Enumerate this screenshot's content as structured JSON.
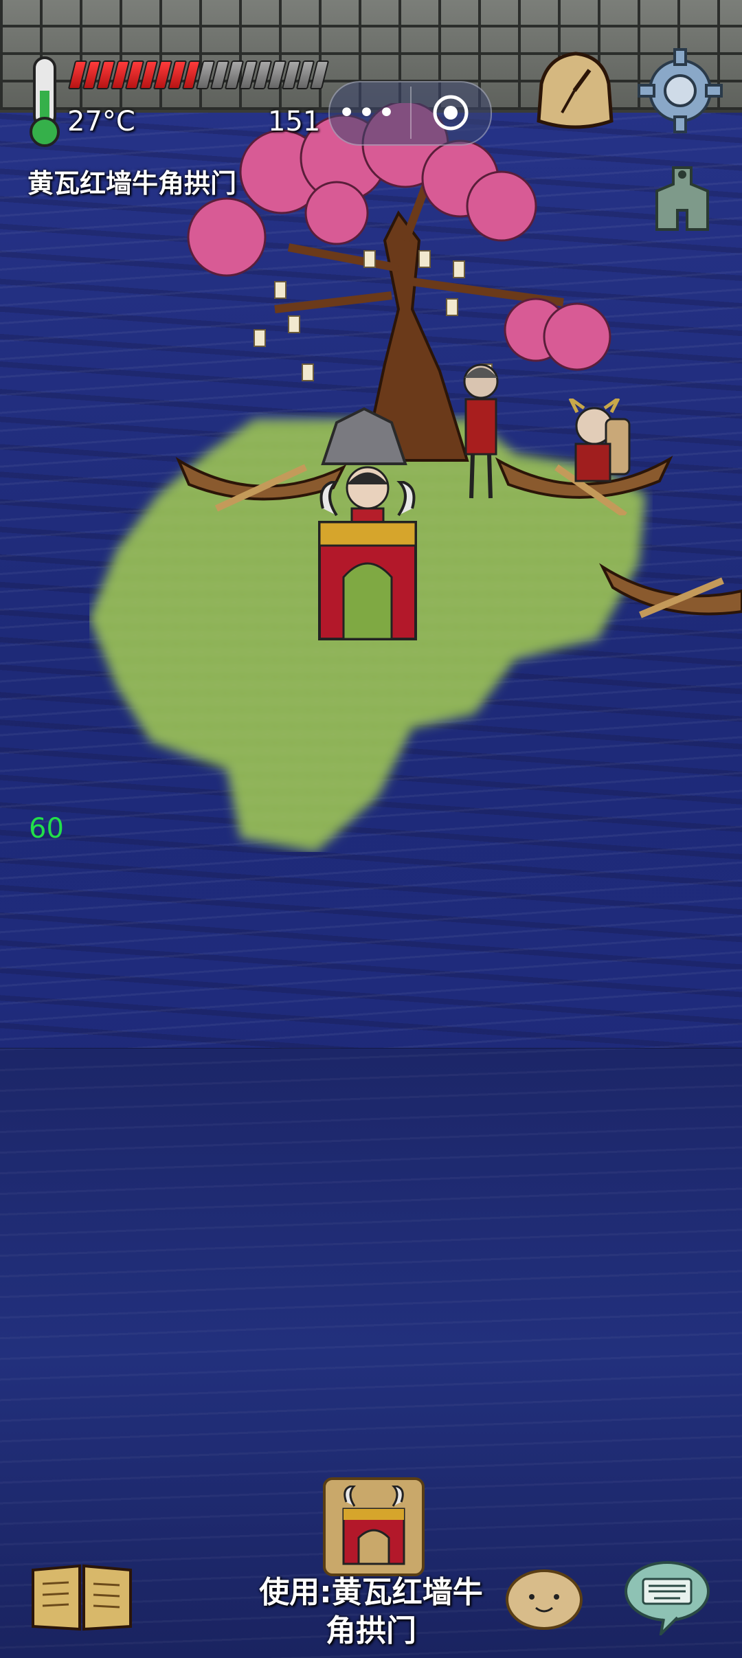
{
  "hud": {
    "temperature": "27°C",
    "counter": "151",
    "health_fraction": 0.5,
    "fps": "60"
  },
  "location": {
    "title": "黄瓦红墙牛角拱门"
  },
  "bottom_bar": {
    "use_label_line1": "使用:黄瓦红墙牛",
    "use_label_line2": "角拱门"
  },
  "icons": [
    "thermometer-icon",
    "health-bar",
    "menu-dots-icon",
    "record-icon",
    "sundial-icon",
    "gear-icon",
    "spade-coin-icon",
    "recipe-book-icon",
    "emote-face-icon",
    "keyboard-chat-icon",
    "horn-arch-item-icon"
  ],
  "colors": {
    "water": "#1e2a78",
    "grass": "#7fa943",
    "fps_text": "#22e04a",
    "health_on": "#e02020"
  }
}
